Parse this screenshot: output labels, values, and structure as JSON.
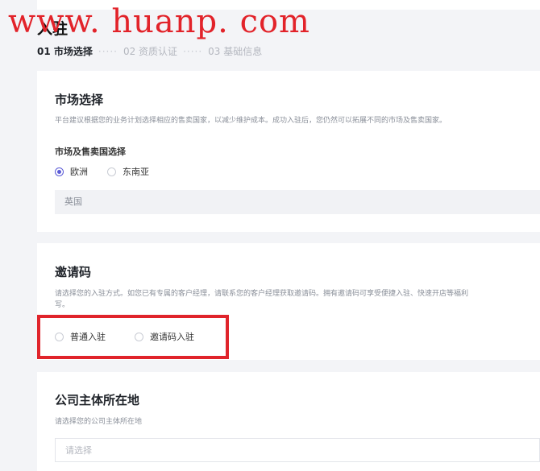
{
  "watermark": "www. huanp. com",
  "page": {
    "title": "入驻",
    "steps": [
      {
        "label": "01 市场选择",
        "active": true
      },
      {
        "label": "02 资质认证",
        "active": false
      },
      {
        "label": "03 基础信息",
        "active": false
      }
    ],
    "step_separator": "·····"
  },
  "market_section": {
    "title": "市场选择",
    "description": "平台建议根据您的业务计划选择相应的售卖国家，以减少维护成本。成功入驻后，您仍然可以拓展不同的市场及售卖国家。",
    "field_label": "市场及售卖国选择",
    "options": [
      "欧洲",
      "东南亚"
    ],
    "selected_option": "欧洲",
    "country_select_value": "英国"
  },
  "invite_section": {
    "title": "邀请码",
    "description_line1": "请选择您的入驻方式。如您已有专属的客户经理，请联系您的客户经理获取邀请码。拥有邀请码可享受便捷入驻、快速开店等福利",
    "description_line2": "写。",
    "options": [
      "普通入驻",
      "邀请码入驻"
    ],
    "selected_option": null
  },
  "company_section": {
    "title": "公司主体所在地",
    "description": "请选择您的公司主体所在地",
    "select_placeholder": "请选择"
  },
  "colors": {
    "accent": "#5b5bd6",
    "highlight": "#e0242b",
    "watermark": "#e2232a"
  }
}
